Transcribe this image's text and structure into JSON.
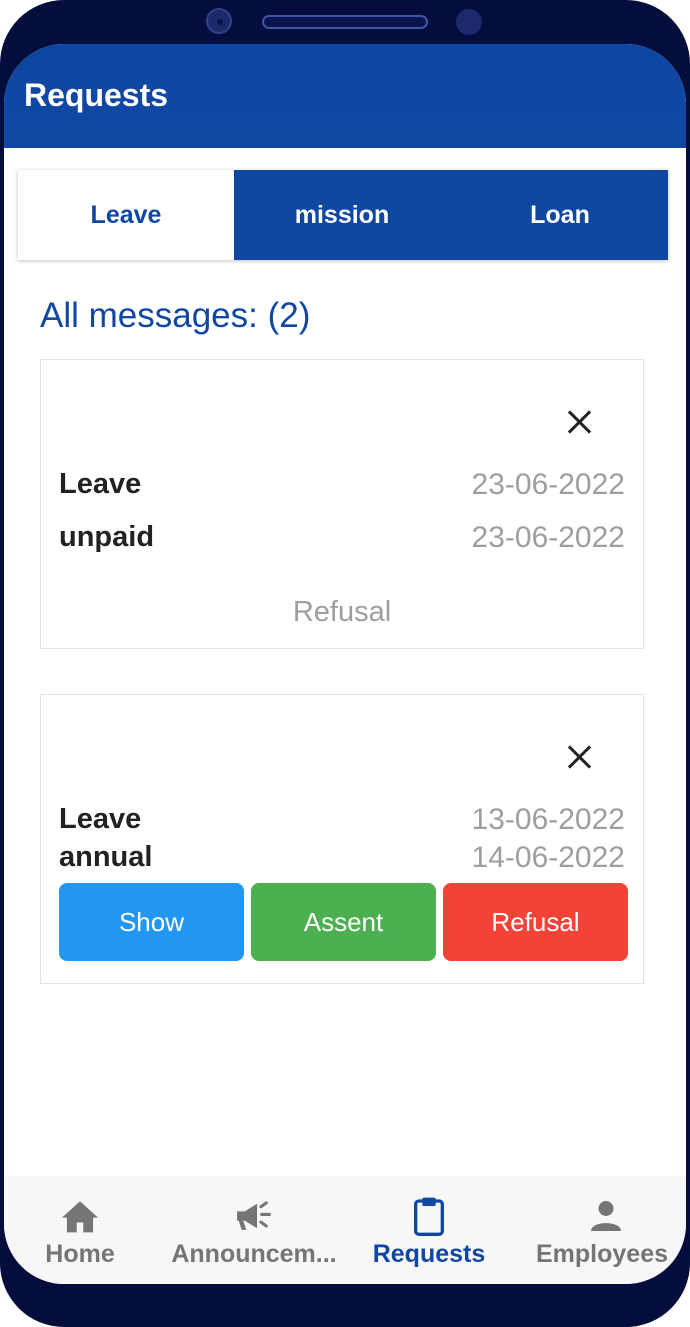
{
  "header": {
    "title": "Requests"
  },
  "tabs": [
    {
      "label": "Leave",
      "active": true
    },
    {
      "label": "mission",
      "active": false
    },
    {
      "label": "Loan",
      "active": false
    }
  ],
  "messages": {
    "count_label": "All messages: (2)"
  },
  "cards": [
    {
      "type": "Leave",
      "subtype": "unpaid",
      "start_date": "23-06-2022",
      "end_date": "23-06-2022",
      "status": "Refusal"
    },
    {
      "type": "Leave",
      "subtype": "annual",
      "start_date": "13-06-2022",
      "end_date": "14-06-2022",
      "actions": {
        "show": "Show",
        "assent": "Assent",
        "refusal": "Refusal"
      }
    }
  ],
  "bottom_nav": [
    {
      "label": "Home",
      "icon": "home-icon"
    },
    {
      "label": "Announcem...",
      "icon": "megaphone-icon"
    },
    {
      "label": "Requests",
      "icon": "clipboard-icon",
      "active": true
    },
    {
      "label": "Employees",
      "icon": "person-icon"
    }
  ],
  "colors": {
    "primary": "#0f47a3",
    "show": "#2196f3",
    "assent": "#4caf50",
    "refusal": "#f44336",
    "frame": "#050d3d"
  }
}
